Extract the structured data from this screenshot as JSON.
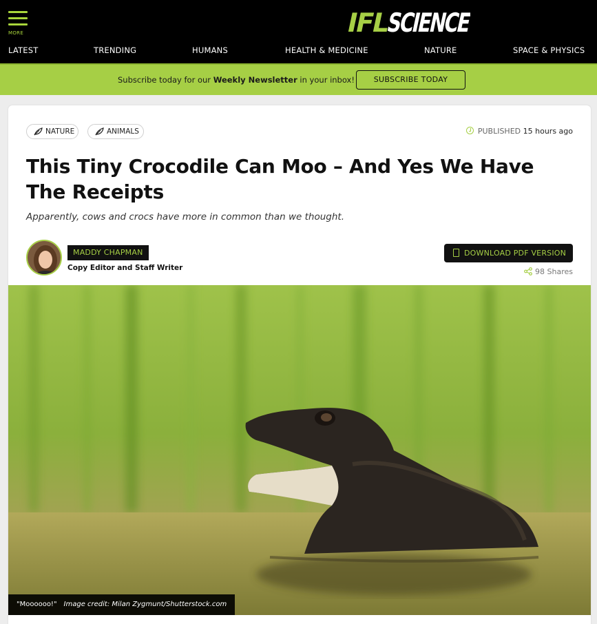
{
  "header": {
    "menu_label": "MORE",
    "logo_text": "IFLSCIENCE",
    "nav": [
      {
        "label": "LATEST"
      },
      {
        "label": "TRENDING"
      },
      {
        "label": "HUMANS"
      },
      {
        "label": "HEALTH & MEDICINE"
      },
      {
        "label": "NATURE"
      },
      {
        "label": "SPACE & PHYSICS"
      }
    ]
  },
  "newsletter": {
    "text_before": "Subscribe today for our ",
    "text_bold": "Weekly Newsletter",
    "text_after": " in your inbox!",
    "button_label": "SUBSCRIBE TODAY"
  },
  "article": {
    "tags": [
      {
        "label": "NATURE"
      },
      {
        "label": "ANIMALS"
      }
    ],
    "published_label": "PUBLISHED",
    "published_time": "15 hours ago",
    "title": "This Tiny Crocodile Can Moo – And Yes We Have The Receipts",
    "subtitle": "Apparently, cows and crocs have more in common than we thought.",
    "author": {
      "name": "MADDY CHAPMAN",
      "role": "Copy Editor and Staff Writer"
    },
    "pdf_button": "DOWNLOAD PDF VERSION",
    "shares": "98 Shares",
    "image": {
      "caption": "\"Moooooo!\"",
      "credit": "Image credit: Milan Zygmunt/Shutterstock.com"
    }
  },
  "colors": {
    "brand_green": "#a6cf45",
    "header_bg": "#000000"
  },
  "icons": [
    "menu-icon",
    "leaf-icon",
    "clock-icon",
    "pdf-icon",
    "share-icon"
  ]
}
